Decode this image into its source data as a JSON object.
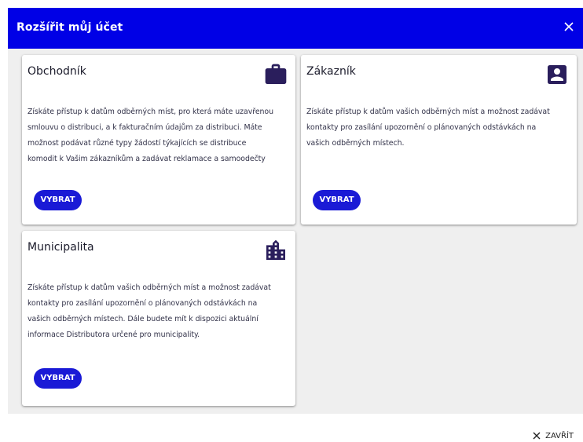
{
  "dialog": {
    "title": "Rozšířit můj účet",
    "close_label": "ZAVŘÍT"
  },
  "cards": [
    {
      "title": "Obchodník",
      "icon": "briefcase-icon",
      "desc_lines": [
        "Získáte přístup k datům odběrných míst, pro která máte uzavřenou",
        "smlouvu o distribuci, a k fakturačním údajům za distribuci. Máte",
        "možnost podávat různé typy žádostí týkajících se distribuce",
        "komodit k Vašim zákazníkům a zadávat reklamace a samoodečty"
      ],
      "button": "VYBRAT"
    },
    {
      "title": "Zákazník",
      "icon": "account-box-icon",
      "desc_lines": [
        "Získáte přístup k datům vašich odběrných míst a možnost zadávat",
        "kontakty pro zasílání upozornění o plánovaných odstávkách na",
        "vašich odběrných místech."
      ],
      "button": "VYBRAT"
    },
    {
      "title": "Municipalita",
      "icon": "city-icon",
      "desc_lines": [
        "Získáte přístup k datům vašich odběrných míst a možnost zadávat",
        "kontakty pro zasílání upozornění o plánovaných odstávkách na",
        "vašich odběrných místech. Dále budete mít k dispozici aktuální",
        "informace Distributora určené pro municipality."
      ],
      "button": "VYBRAT"
    }
  ],
  "colors": {
    "header": "#0000e6",
    "button": "#1a1ad6",
    "icon": "#2a1e5c"
  }
}
